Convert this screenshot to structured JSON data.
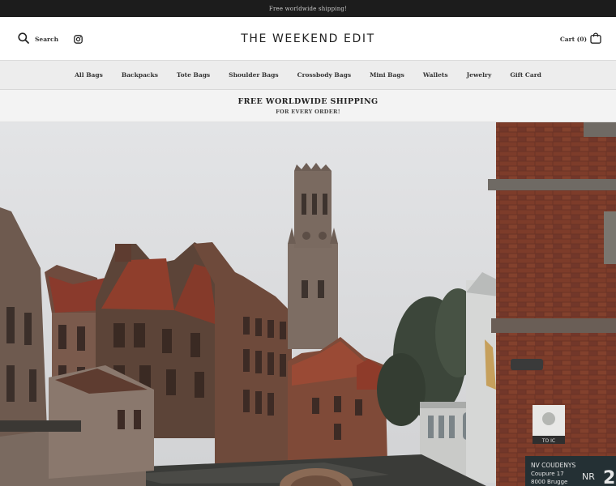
{
  "announcement": {
    "text": "Free worldwide shipping!"
  },
  "header": {
    "search_label": "Search",
    "logo": "THE WEEKEND EDIT",
    "cart_label": "Cart (0)"
  },
  "nav": {
    "items": [
      "All Bags",
      "Backpacks",
      "Tote Bags",
      "Shoulder Bags",
      "Crossbody Bags",
      "Mini Bags",
      "Wallets",
      "Jewelry",
      "Gift Card"
    ]
  },
  "promo": {
    "title": "FREE WORLDWIDE SHIPPING",
    "subtitle": "FOR EVERY ORDER!"
  },
  "hero": {
    "sign_line1": "NV COUDENYS",
    "sign_line2": "Coupure 17",
    "sign_line3": "8000 Brugge",
    "sign_nr": "NR",
    "sign_digit": "2",
    "plaque_text": "TO IC"
  }
}
